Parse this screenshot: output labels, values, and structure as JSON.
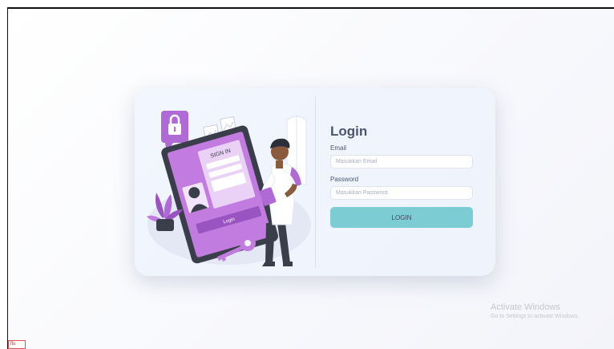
{
  "login": {
    "title": "Login",
    "email_label": "Email",
    "email_placeholder": "Masukkan Email",
    "email_value": "",
    "password_label": "Password",
    "password_placeholder": "Masukkan Password",
    "password_value": "",
    "button_label": "LOGIN"
  },
  "illustration": {
    "sign_in_text": "SIGN IN",
    "login_text": "Login"
  },
  "watermark": {
    "title": "Activate Windows",
    "subtitle": "Go to Settings to activate Windows."
  },
  "corner_tag": "flu",
  "colors": {
    "accent_purple": "#b06ad6",
    "button_teal": "#7ccdd3",
    "title_text": "#4a5670",
    "card_bg": "#eef3fc"
  }
}
